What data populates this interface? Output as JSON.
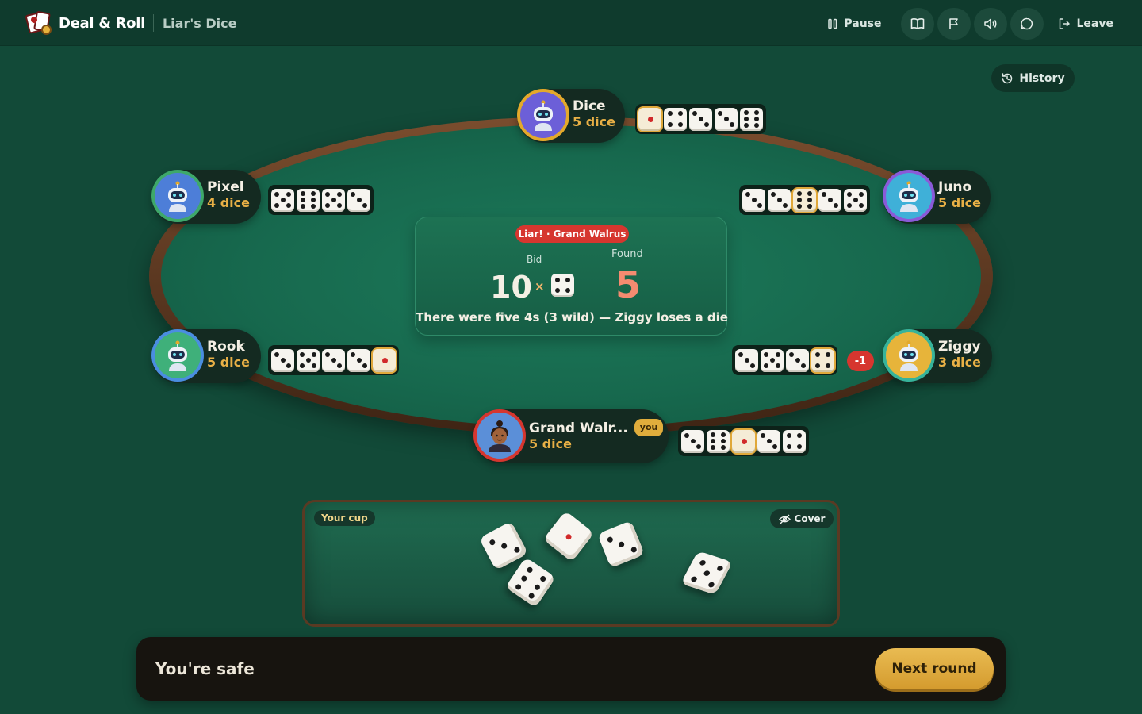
{
  "header": {
    "brand_name": "Deal & Roll",
    "game_name": "Liar's Dice",
    "pause_label": "Pause",
    "leave_label": "Leave",
    "icons": [
      "rules-book-icon",
      "flag-icon",
      "sound-icon",
      "chat-icon"
    ]
  },
  "history_label": "History",
  "result": {
    "tag": "Liar! · Grand Walrus",
    "bid_label": "Bid",
    "found_label": "Found",
    "bid_count": "10",
    "bid_times": "×",
    "bid_face": 4,
    "found_count": "5",
    "message": "There were five 4s (3 wild) — Ziggy loses a die"
  },
  "players": {
    "dice": {
      "name": "Dice",
      "dice_label": "5 dice",
      "faces": [
        1,
        4,
        3,
        3,
        6
      ],
      "highlight": [
        0
      ]
    },
    "pixel": {
      "name": "Pixel",
      "dice_label": "4 dice",
      "faces": [
        5,
        6,
        5,
        3
      ],
      "highlight": []
    },
    "juno": {
      "name": "Juno",
      "dice_label": "5 dice",
      "faces": [
        3,
        3,
        6,
        3,
        5
      ],
      "highlight": [
        2
      ]
    },
    "rook": {
      "name": "Rook",
      "dice_label": "5 dice",
      "faces": [
        3,
        5,
        3,
        3,
        1
      ],
      "highlight": [
        4
      ]
    },
    "ziggy": {
      "name": "Ziggy",
      "dice_label": "3 dice",
      "faces": [
        3,
        5,
        3,
        4
      ],
      "highlight": [
        3
      ],
      "loss_badge": "-1"
    },
    "you": {
      "name": "Grand Walr...",
      "badge": "you",
      "dice_label": "5 dice",
      "faces": [
        3,
        6,
        1,
        3,
        4
      ],
      "highlight": [
        2
      ]
    }
  },
  "cup": {
    "label": "Your cup",
    "cover_label": "Cover",
    "dice_faces": [
      3,
      6,
      1,
      3,
      5
    ]
  },
  "bottom": {
    "status": "You're safe",
    "next_label": "Next round"
  },
  "colors": {
    "felt": "#17694e",
    "accent_gold": "#e0ad3c",
    "loss_red": "#d6362f",
    "found_salmon": "#f58b70"
  }
}
